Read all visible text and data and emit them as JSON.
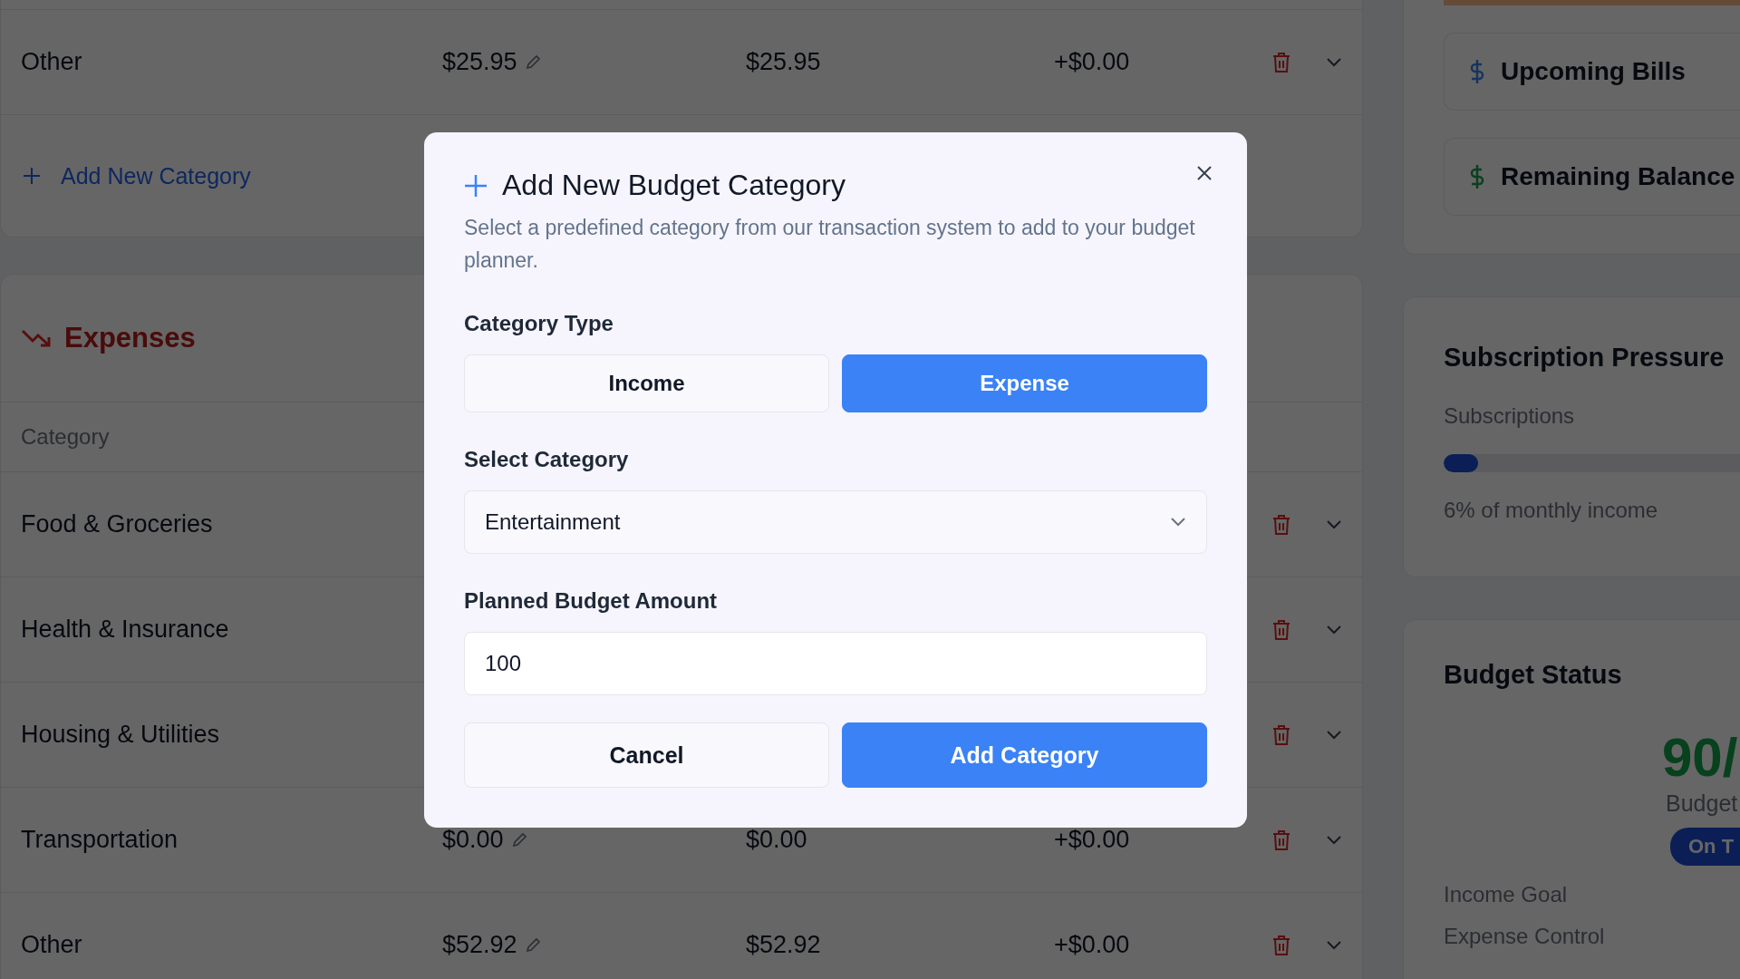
{
  "income_tail": {
    "rows": [
      {
        "name": "Other",
        "planned": "$25.95",
        "actual": "$25.95",
        "difference": "+$0.00"
      }
    ],
    "add_link": "Add New Category"
  },
  "expenses": {
    "title": "Expenses",
    "columns": [
      "Category"
    ],
    "rows": [
      {
        "name": "Food & Groceries"
      },
      {
        "name": "Health & Insurance"
      },
      {
        "name": "Housing & Utilities"
      },
      {
        "name": "Transportation",
        "planned": "$0.00",
        "actual": "$0.00",
        "difference": "+$0.00"
      },
      {
        "name": "Other",
        "planned": "$52.92",
        "actual": "$52.92",
        "difference": "+$0.00"
      }
    ]
  },
  "sidebar": {
    "quick_links": [
      {
        "label": "Upcoming Bills",
        "color": "#18345e"
      },
      {
        "label": "Remaining Balance",
        "color": "#09401f"
      }
    ],
    "subscription_pressure": {
      "title": "Subscription Pressure",
      "label": "Subscriptions",
      "level": 0.06,
      "note": "6% of monthly income"
    },
    "budget_status": {
      "title": "Budget Status",
      "score": "90/",
      "score_label": "Budget",
      "badge": "On T",
      "metrics": [
        "Income Goal",
        "Expense Control"
      ]
    }
  },
  "modal": {
    "title": "Add New Budget Category",
    "description": "Select a predefined category from our transaction system to add to your budget planner.",
    "type_label": "Category Type",
    "type_options": [
      {
        "label": "Income",
        "selected": false
      },
      {
        "label": "Expense",
        "selected": true
      }
    ],
    "select_label": "Select Category",
    "select_value": "Entertainment",
    "amount_label": "Planned Budget Amount",
    "amount_value": "100",
    "buttons": [
      {
        "label": "Cancel",
        "kind": "secondary"
      },
      {
        "label": "Add Category",
        "kind": "primary"
      }
    ]
  }
}
